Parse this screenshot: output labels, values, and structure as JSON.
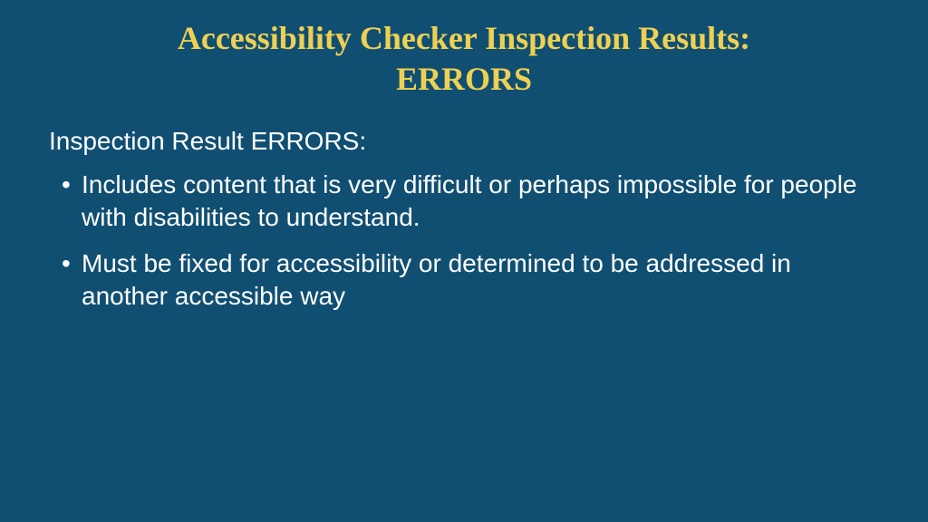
{
  "slide": {
    "title_line1": "Accessibility Checker Inspection Results:",
    "title_line2": "ERRORS",
    "subtitle": "Inspection Result ERRORS:",
    "bullets": [
      "Includes content that is very difficult or perhaps impossible for people with disabilities to understand.",
      "Must be fixed for accessibility or determined to be addressed in another accessible way"
    ]
  }
}
